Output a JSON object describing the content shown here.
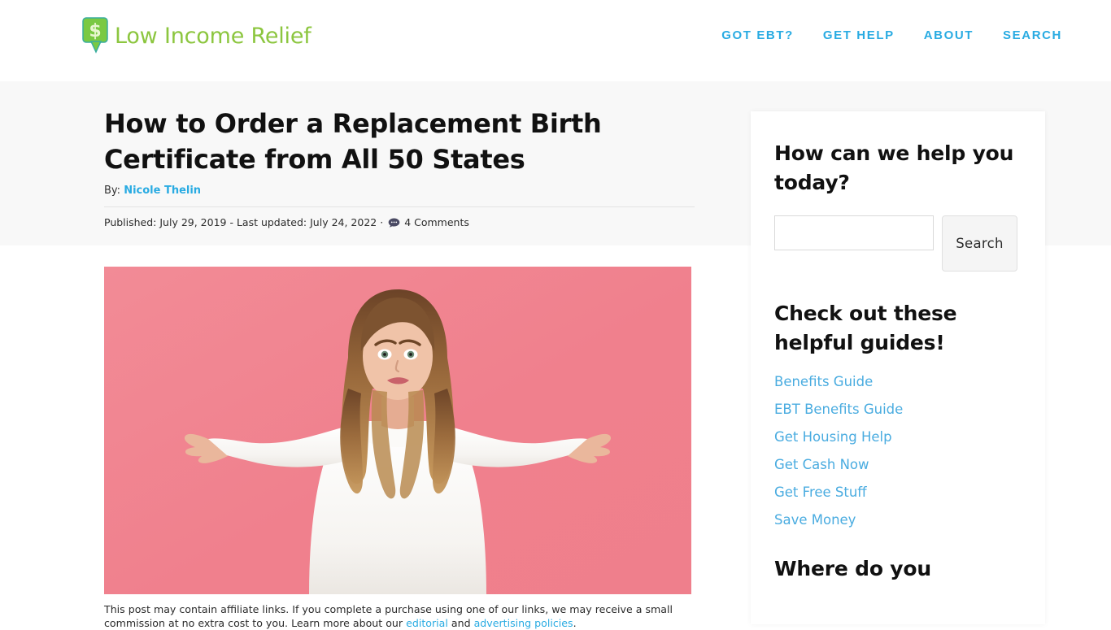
{
  "header": {
    "logo": {
      "icon": "dollar-pin-icon",
      "text": "Low Income Relief",
      "icon_color": "#8cc63f",
      "text_color": "#8cc63f"
    },
    "nav": [
      {
        "label": "GOT EBT?"
      },
      {
        "label": "GET HELP"
      },
      {
        "label": "ABOUT"
      },
      {
        "label": "SEARCH"
      }
    ],
    "nav_color": "#29abe2"
  },
  "article": {
    "title": "How to Order a Replacement Birth Certificate from All 50 States",
    "byline_label": "By:",
    "author": "Nicole Thelin",
    "meta_text": "Published: July 29, 2019 - Last updated: July 24, 2022 ·",
    "comments_icon": "comment-bubble-icon",
    "comments_count": "4 Comments",
    "featured_image_alt": "Woman in white sweater shrugging with palms up in front of a pink background",
    "featured_image_bg": "#f08490",
    "affiliate_note": {
      "part1": "This post may contain affiliate links. If you complete a purchase using one of our links, we may receive a small commission at no extra cost to you. Learn more about our ",
      "link1": "editorial",
      "part2": " and ",
      "link2": "advertising policies",
      "part3": "."
    }
  },
  "sidebar": {
    "help_widget": {
      "title": "How can we help you today?",
      "search_value": "",
      "search_placeholder": "",
      "search_button": "Search"
    },
    "guides_widget": {
      "title": "Check out these helpful guides!",
      "links": [
        {
          "label": "Benefits Guide"
        },
        {
          "label": "EBT Benefits Guide"
        },
        {
          "label": "Get Housing Help"
        },
        {
          "label": "Get Cash Now"
        },
        {
          "label": "Get Free Stuff"
        },
        {
          "label": "Save Money"
        }
      ]
    },
    "location_widget": {
      "title": "Where do you"
    }
  }
}
